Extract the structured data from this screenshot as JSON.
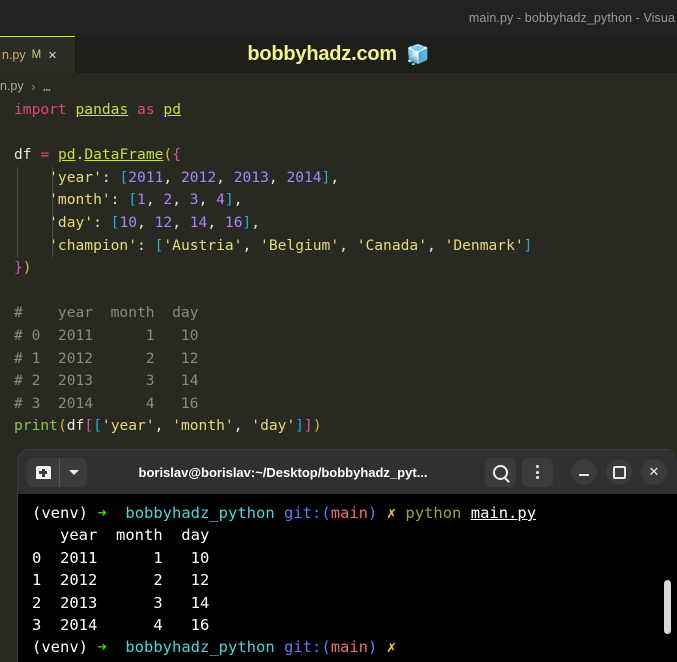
{
  "window": {
    "title": "main.py - bobbyhadz_python - Visua",
    "watermark_text": "bobbyhadz.com",
    "watermark_icon": "ice-cube-emoji",
    "watermark_glyph": "🧊"
  },
  "tab": {
    "label": "n.py",
    "dirty_indicator": "M",
    "close_glyph": "✕"
  },
  "breadcrumb": {
    "file": "n.py",
    "separator": "›",
    "overflow": "…"
  },
  "editor": {
    "lines": [
      {
        "id": 1,
        "tokens": [
          {
            "t": "import",
            "c": "t-kw"
          },
          {
            "t": " ",
            "c": "t-var"
          },
          {
            "t": "pandas",
            "c": "t-mod"
          },
          {
            "t": " ",
            "c": "t-var"
          },
          {
            "t": "as",
            "c": "t-kw"
          },
          {
            "t": " ",
            "c": "t-var"
          },
          {
            "t": "pd",
            "c": "t-mod"
          }
        ]
      },
      {
        "id": 2,
        "tokens": []
      },
      {
        "id": 3,
        "tokens": [
          {
            "t": "df ",
            "c": "t-var"
          },
          {
            "t": "=",
            "c": "t-op"
          },
          {
            "t": " ",
            "c": "t-var"
          },
          {
            "t": "pd",
            "c": "t-mod"
          },
          {
            "t": ".",
            "c": "b-punct"
          },
          {
            "t": "DataFrame",
            "c": "t-fn"
          },
          {
            "t": "(",
            "c": "b-yellow"
          },
          {
            "t": "{",
            "c": "b-pink"
          }
        ]
      },
      {
        "id": 4,
        "indent": 1,
        "tokens": [
          {
            "t": "    'year'",
            "c": "t-str"
          },
          {
            "t": ": ",
            "c": "b-punct"
          },
          {
            "t": "[",
            "c": "b-blue"
          },
          {
            "t": "2011",
            "c": "t-num"
          },
          {
            "t": ", ",
            "c": "b-punct"
          },
          {
            "t": "2012",
            "c": "t-num"
          },
          {
            "t": ", ",
            "c": "b-punct"
          },
          {
            "t": "2013",
            "c": "t-num"
          },
          {
            "t": ", ",
            "c": "b-punct"
          },
          {
            "t": "2014",
            "c": "t-num"
          },
          {
            "t": "]",
            "c": "b-blue"
          },
          {
            "t": ",",
            "c": "b-punct"
          }
        ]
      },
      {
        "id": 5,
        "indent": 1,
        "tokens": [
          {
            "t": "    'month'",
            "c": "t-str"
          },
          {
            "t": ": ",
            "c": "b-punct"
          },
          {
            "t": "[",
            "c": "b-blue"
          },
          {
            "t": "1",
            "c": "t-num"
          },
          {
            "t": ", ",
            "c": "b-punct"
          },
          {
            "t": "2",
            "c": "t-num"
          },
          {
            "t": ", ",
            "c": "b-punct"
          },
          {
            "t": "3",
            "c": "t-num"
          },
          {
            "t": ", ",
            "c": "b-punct"
          },
          {
            "t": "4",
            "c": "t-num"
          },
          {
            "t": "]",
            "c": "b-blue"
          },
          {
            "t": ",",
            "c": "b-punct"
          }
        ]
      },
      {
        "id": 6,
        "indent": 1,
        "tokens": [
          {
            "t": "    'day'",
            "c": "t-str"
          },
          {
            "t": ": ",
            "c": "b-punct"
          },
          {
            "t": "[",
            "c": "b-blue"
          },
          {
            "t": "10",
            "c": "t-num"
          },
          {
            "t": ", ",
            "c": "b-punct"
          },
          {
            "t": "12",
            "c": "t-num"
          },
          {
            "t": ", ",
            "c": "b-punct"
          },
          {
            "t": "14",
            "c": "t-num"
          },
          {
            "t": ", ",
            "c": "b-punct"
          },
          {
            "t": "16",
            "c": "t-num"
          },
          {
            "t": "]",
            "c": "b-blue"
          },
          {
            "t": ",",
            "c": "b-punct"
          }
        ]
      },
      {
        "id": 7,
        "indent": 1,
        "tokens": [
          {
            "t": "    'champion'",
            "c": "t-str"
          },
          {
            "t": ": ",
            "c": "b-punct"
          },
          {
            "t": "[",
            "c": "b-blue"
          },
          {
            "t": "'Austria'",
            "c": "t-str"
          },
          {
            "t": ", ",
            "c": "b-punct"
          },
          {
            "t": "'Belgium'",
            "c": "t-str"
          },
          {
            "t": ", ",
            "c": "b-punct"
          },
          {
            "t": "'Canada'",
            "c": "t-str"
          },
          {
            "t": ", ",
            "c": "b-punct"
          },
          {
            "t": "'Denmark'",
            "c": "t-str"
          },
          {
            "t": "]",
            "c": "b-blue"
          }
        ]
      },
      {
        "id": 8,
        "tokens": [
          {
            "t": "}",
            "c": "b-pink"
          },
          {
            "t": ")",
            "c": "b-yellow"
          }
        ]
      },
      {
        "id": 9,
        "tokens": []
      },
      {
        "id": 10,
        "tokens": [
          {
            "t": "#    year  month  day",
            "c": "t-cmt"
          }
        ]
      },
      {
        "id": 11,
        "tokens": [
          {
            "t": "# 0  2011      1   10",
            "c": "t-cmt"
          }
        ]
      },
      {
        "id": 12,
        "tokens": [
          {
            "t": "# 1  2012      2   12",
            "c": "t-cmt"
          }
        ]
      },
      {
        "id": 13,
        "tokens": [
          {
            "t": "# 2  2013      3   14",
            "c": "t-cmt"
          }
        ]
      },
      {
        "id": 14,
        "tokens": [
          {
            "t": "# 3  2014      4   16",
            "c": "t-cmt"
          }
        ]
      },
      {
        "id": 15,
        "tokens": [
          {
            "t": "print",
            "c": "t-call"
          },
          {
            "t": "(",
            "c": "b-yellow"
          },
          {
            "t": "df",
            "c": "t-var"
          },
          {
            "t": "[",
            "c": "b-pink"
          },
          {
            "t": "[",
            "c": "b-blue"
          },
          {
            "t": "'year'",
            "c": "t-str"
          },
          {
            "t": ", ",
            "c": "b-punct"
          },
          {
            "t": "'month'",
            "c": "t-str"
          },
          {
            "t": ", ",
            "c": "b-punct"
          },
          {
            "t": "'day'",
            "c": "t-str"
          },
          {
            "t": "]",
            "c": "b-blue"
          },
          {
            "t": "]",
            "c": "b-pink"
          },
          {
            "t": ")",
            "c": "b-yellow"
          }
        ]
      }
    ]
  },
  "terminal": {
    "titlebar": {
      "title": "borislav@borislav:~/Desktop/bobbyhadz_pyt...",
      "new_tab_icon": "new-tab-icon",
      "dropdown_icon": "chevron-down-icon",
      "search_icon": "search-icon",
      "menu_icon": "kebab-menu-icon",
      "minimize_glyph": "–",
      "maximize_glyph": "□",
      "close_glyph": "✕"
    },
    "lines": [
      {
        "id": 1,
        "tokens": [
          {
            "t": "(venv)",
            "c": "c-white"
          },
          {
            "t": " ",
            "c": "c-white"
          },
          {
            "t": "➜",
            "c": "c-green"
          },
          {
            "t": "  ",
            "c": "c-white"
          },
          {
            "t": "bobbyhadz_python",
            "c": "c-cyan"
          },
          {
            "t": " ",
            "c": "c-white"
          },
          {
            "t": "git:",
            "c": "c-blue"
          },
          {
            "t": "(",
            "c": "c-blue"
          },
          {
            "t": "main",
            "c": "c-red"
          },
          {
            "t": ")",
            "c": "c-blue"
          },
          {
            "t": " ",
            "c": "c-white"
          },
          {
            "t": "✗",
            "c": "c-yellow"
          },
          {
            "t": " ",
            "c": "c-white"
          },
          {
            "t": "python",
            "c": "c-olive"
          },
          {
            "t": " ",
            "c": "c-white"
          },
          {
            "t": "main.py",
            "c": "c-under"
          }
        ]
      },
      {
        "id": 2,
        "tokens": [
          {
            "t": "   year  month  day",
            "c": "c-white"
          }
        ]
      },
      {
        "id": 3,
        "tokens": [
          {
            "t": "0  2011      1   10",
            "c": "c-white"
          }
        ]
      },
      {
        "id": 4,
        "tokens": [
          {
            "t": "1  2012      2   12",
            "c": "c-white"
          }
        ]
      },
      {
        "id": 5,
        "tokens": [
          {
            "t": "2  2013      3   14",
            "c": "c-white"
          }
        ]
      },
      {
        "id": 6,
        "tokens": [
          {
            "t": "3  2014      4   16",
            "c": "c-white"
          }
        ]
      },
      {
        "id": 7,
        "tokens": [
          {
            "t": "(venv)",
            "c": "c-white"
          },
          {
            "t": " ",
            "c": "c-white"
          },
          {
            "t": "➜",
            "c": "c-green"
          },
          {
            "t": "  ",
            "c": "c-white"
          },
          {
            "t": "bobbyhadz_python",
            "c": "c-cyan"
          },
          {
            "t": " ",
            "c": "c-white"
          },
          {
            "t": "git:",
            "c": "c-blue"
          },
          {
            "t": "(",
            "c": "c-blue"
          },
          {
            "t": "main",
            "c": "c-red"
          },
          {
            "t": ")",
            "c": "c-blue"
          },
          {
            "t": " ",
            "c": "c-white"
          },
          {
            "t": "✗",
            "c": "c-yellow"
          }
        ]
      }
    ],
    "dataframe": {
      "columns": [
        "year",
        "month",
        "day"
      ],
      "index": [
        "0",
        "1",
        "2",
        "3"
      ],
      "rows": [
        [
          "2011",
          "1",
          "10"
        ],
        [
          "2012",
          "2",
          "12"
        ],
        [
          "2013",
          "3",
          "14"
        ],
        [
          "2014",
          "4",
          "16"
        ]
      ]
    }
  },
  "colors": {
    "editor_bg": "#282a22",
    "titlebar_bg": "#222222",
    "tabrow_bg": "#1e1f1a",
    "tab_active_border": "#cddc39",
    "terminal_bg": "#000000",
    "terminal_titlebar_bg": "#303030",
    "watermark": "#f2f58a"
  }
}
